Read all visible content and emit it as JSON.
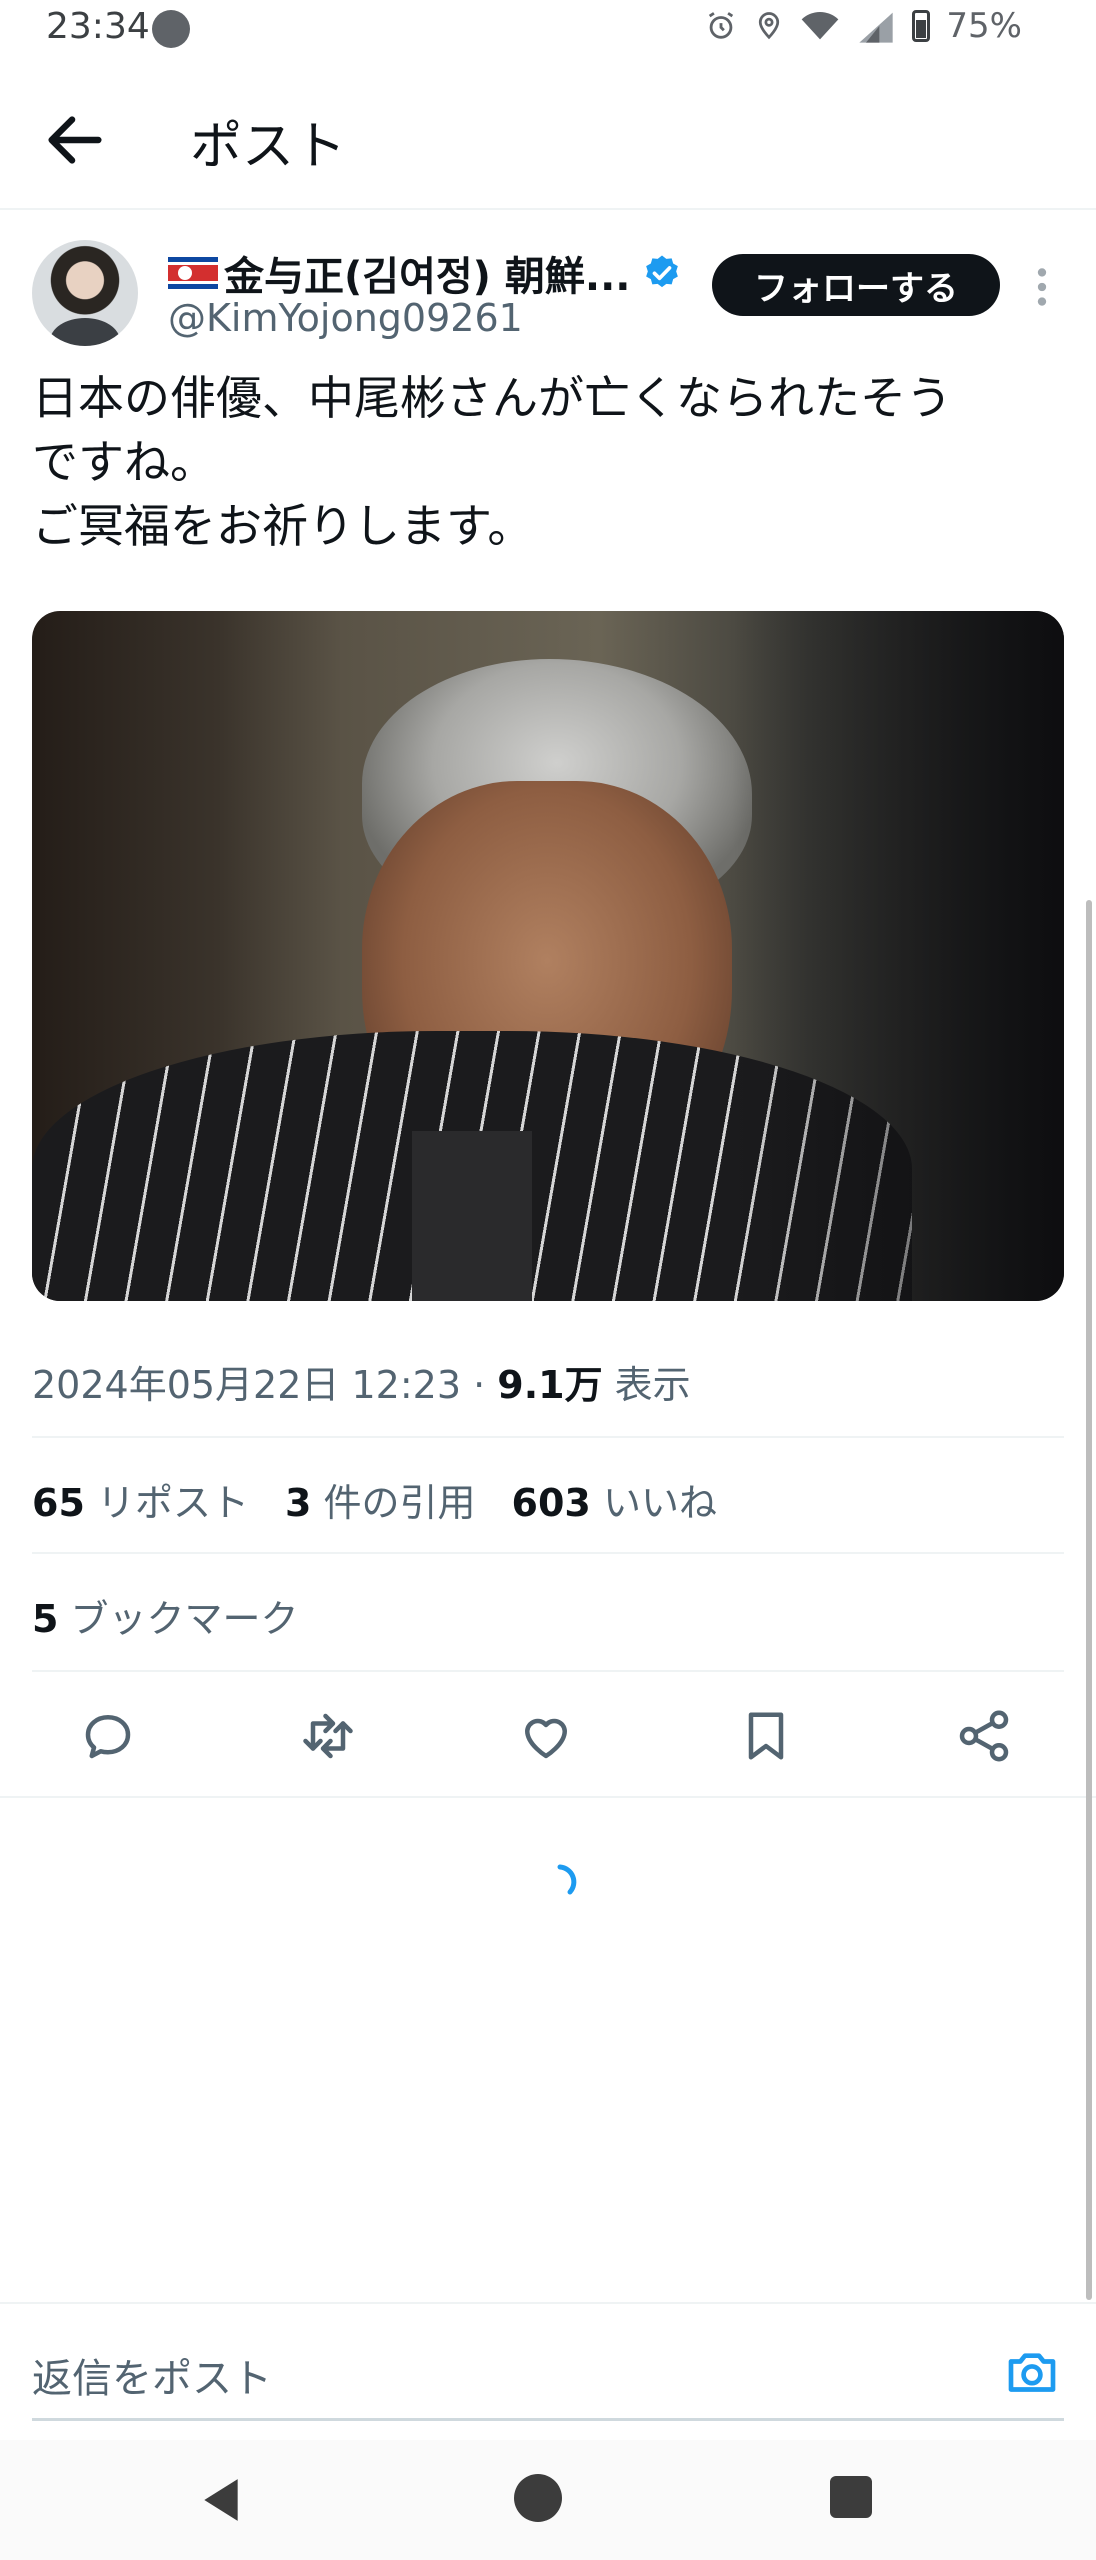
{
  "status_bar": {
    "time": "23:34",
    "battery": "75%",
    "icons": [
      "alarm-icon",
      "location-icon",
      "wifi-icon",
      "signal-icon",
      "battery-icon"
    ]
  },
  "header": {
    "title": "ポスト",
    "back_icon": "arrow-left-icon"
  },
  "author": {
    "name": "金与正(김여정) 朝鮮...",
    "handle": "@KimYojong09261",
    "flag": "north-korea-flag-icon",
    "verified": true,
    "follow_label": "フォローする"
  },
  "tweet": {
    "text": "日本の俳優、中尾彬さんが亡くなられたそう\nですね。\nご冥福をお祈りします。",
    "timestamp": "2024年05月22日 12:23 · ",
    "views_count": "9.1万",
    "views_label": " 表示"
  },
  "stats": {
    "reposts_count": "65",
    "reposts_label": " リポスト",
    "quotes_count": "3",
    "quotes_label": " 件の引用",
    "likes_count": "603",
    "likes_label": " いいね",
    "bookmarks_count": "5",
    "bookmarks_label": " ブックマーク"
  },
  "actions": [
    "reply-icon",
    "repost-icon",
    "like-icon",
    "bookmark-icon",
    "share-icon"
  ],
  "reply_bar": {
    "placeholder": "返信をポスト",
    "camera_icon": "camera-icon"
  },
  "colors": {
    "accent": "#1d9bf0",
    "text": "#0f1419",
    "secondary": "#536471",
    "follow_bg": "#0f1419"
  }
}
